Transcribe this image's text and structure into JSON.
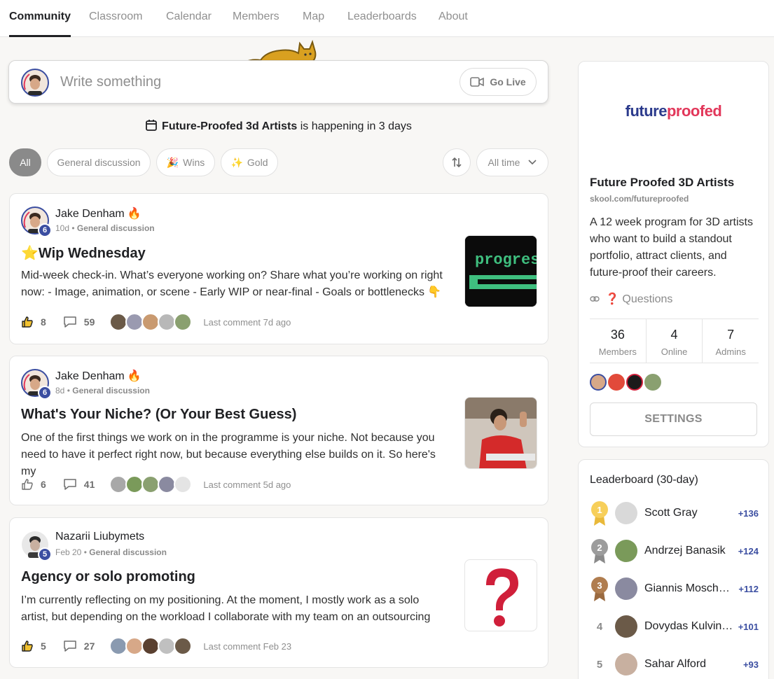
{
  "nav": {
    "tabs": [
      {
        "label": "Community"
      },
      {
        "label": "Classroom"
      },
      {
        "label": "Calendar"
      },
      {
        "label": "Members"
      },
      {
        "label": "Map"
      },
      {
        "label": "Leaderboards"
      },
      {
        "label": "About"
      }
    ],
    "active_tab": "Community"
  },
  "composer": {
    "placeholder": "Write something",
    "go_live_label": "Go Live"
  },
  "event_banner": {
    "event_name": "Future-Proofed 3d Artists",
    "suffix": "is happening in 3 days"
  },
  "filters": {
    "chips": [
      {
        "label": "All",
        "active": true
      },
      {
        "label": "General discussion",
        "active": false
      },
      {
        "label": "Wins",
        "icon": "party-popper-icon",
        "active": false
      },
      {
        "label": "Gold",
        "icon": "sparkles-icon",
        "active": false
      }
    ],
    "time_filter": "All time"
  },
  "posts": [
    {
      "author": "Jake Denham",
      "level": "6",
      "time": "10d",
      "separator": " • ",
      "category": "General discussion",
      "title": "Wip Wednesday",
      "body": "Mid-week check-in. What’s everyone working on? Share what you’re working on right now: - Image, animation, or scene - Early WIP or near-final - Goals or bottlenecks 👇",
      "likes": "8",
      "liked": true,
      "comments": "59",
      "last_comment": "Last comment 7d ago",
      "thumbnail_text": "progres"
    },
    {
      "author": "Jake Denham",
      "level": "6",
      "time": "8d",
      "separator": " • ",
      "category": "General discussion",
      "title": "What's Your Niche? (Or Your Best Guess)",
      "body": "One of the first things we work on in the programme is your niche. Not because you need to have it perfect right now, but because everything else builds on it. So here's my",
      "likes": "6",
      "liked": false,
      "comments": "41",
      "last_comment": "Last comment 5d ago"
    },
    {
      "author": "Nazarii Liubymets",
      "level": "5",
      "time": "Feb 20",
      "separator": " • ",
      "category": "General discussion",
      "title": "Agency or solo promoting",
      "body": "I’m currently reflecting on my positioning. At the moment, I mostly work as a solo artist, but depending on the workload I collaborate with my team on an outsourcing",
      "likes": "5",
      "liked": true,
      "comments": "27",
      "last_comment": "Last comment Feb 23"
    }
  ],
  "group": {
    "logo_part1": "future",
    "logo_part2": "proofed",
    "name": "Future Proofed 3D Artists",
    "url": "skool.com/futureproofed",
    "description": "A 12 week program for 3D artists who want to build a standout portfolio, attract clients, and future-proof their careers.",
    "link_label": "❓ Questions",
    "stats": [
      {
        "value": "36",
        "label": "Members"
      },
      {
        "value": "4",
        "label": "Online"
      },
      {
        "value": "7",
        "label": "Admins"
      }
    ],
    "settings_label": "SETTINGS"
  },
  "leaderboard": {
    "title": "Leaderboard (30-day)",
    "rows": [
      {
        "rank": "1",
        "name": "Scott Gray",
        "points": "+136"
      },
      {
        "rank": "2",
        "name": "Andrzej Banasik",
        "points": "+124"
      },
      {
        "rank": "3",
        "name": "Giannis Moschopoulos",
        "points": "+112"
      },
      {
        "rank": "4",
        "name": "Dovydas Kulvinskas",
        "points": "+101"
      },
      {
        "rank": "5",
        "name": "Sahar Alford",
        "points": "+93"
      }
    ]
  },
  "colors": {
    "brand_blue": "#2b3a8c",
    "brand_pink": "#e2375a",
    "level_badge": "#3b4ea1",
    "gold": "#f5c54c",
    "silver": "#9a9a9a",
    "bronze": "#b07d4f"
  }
}
